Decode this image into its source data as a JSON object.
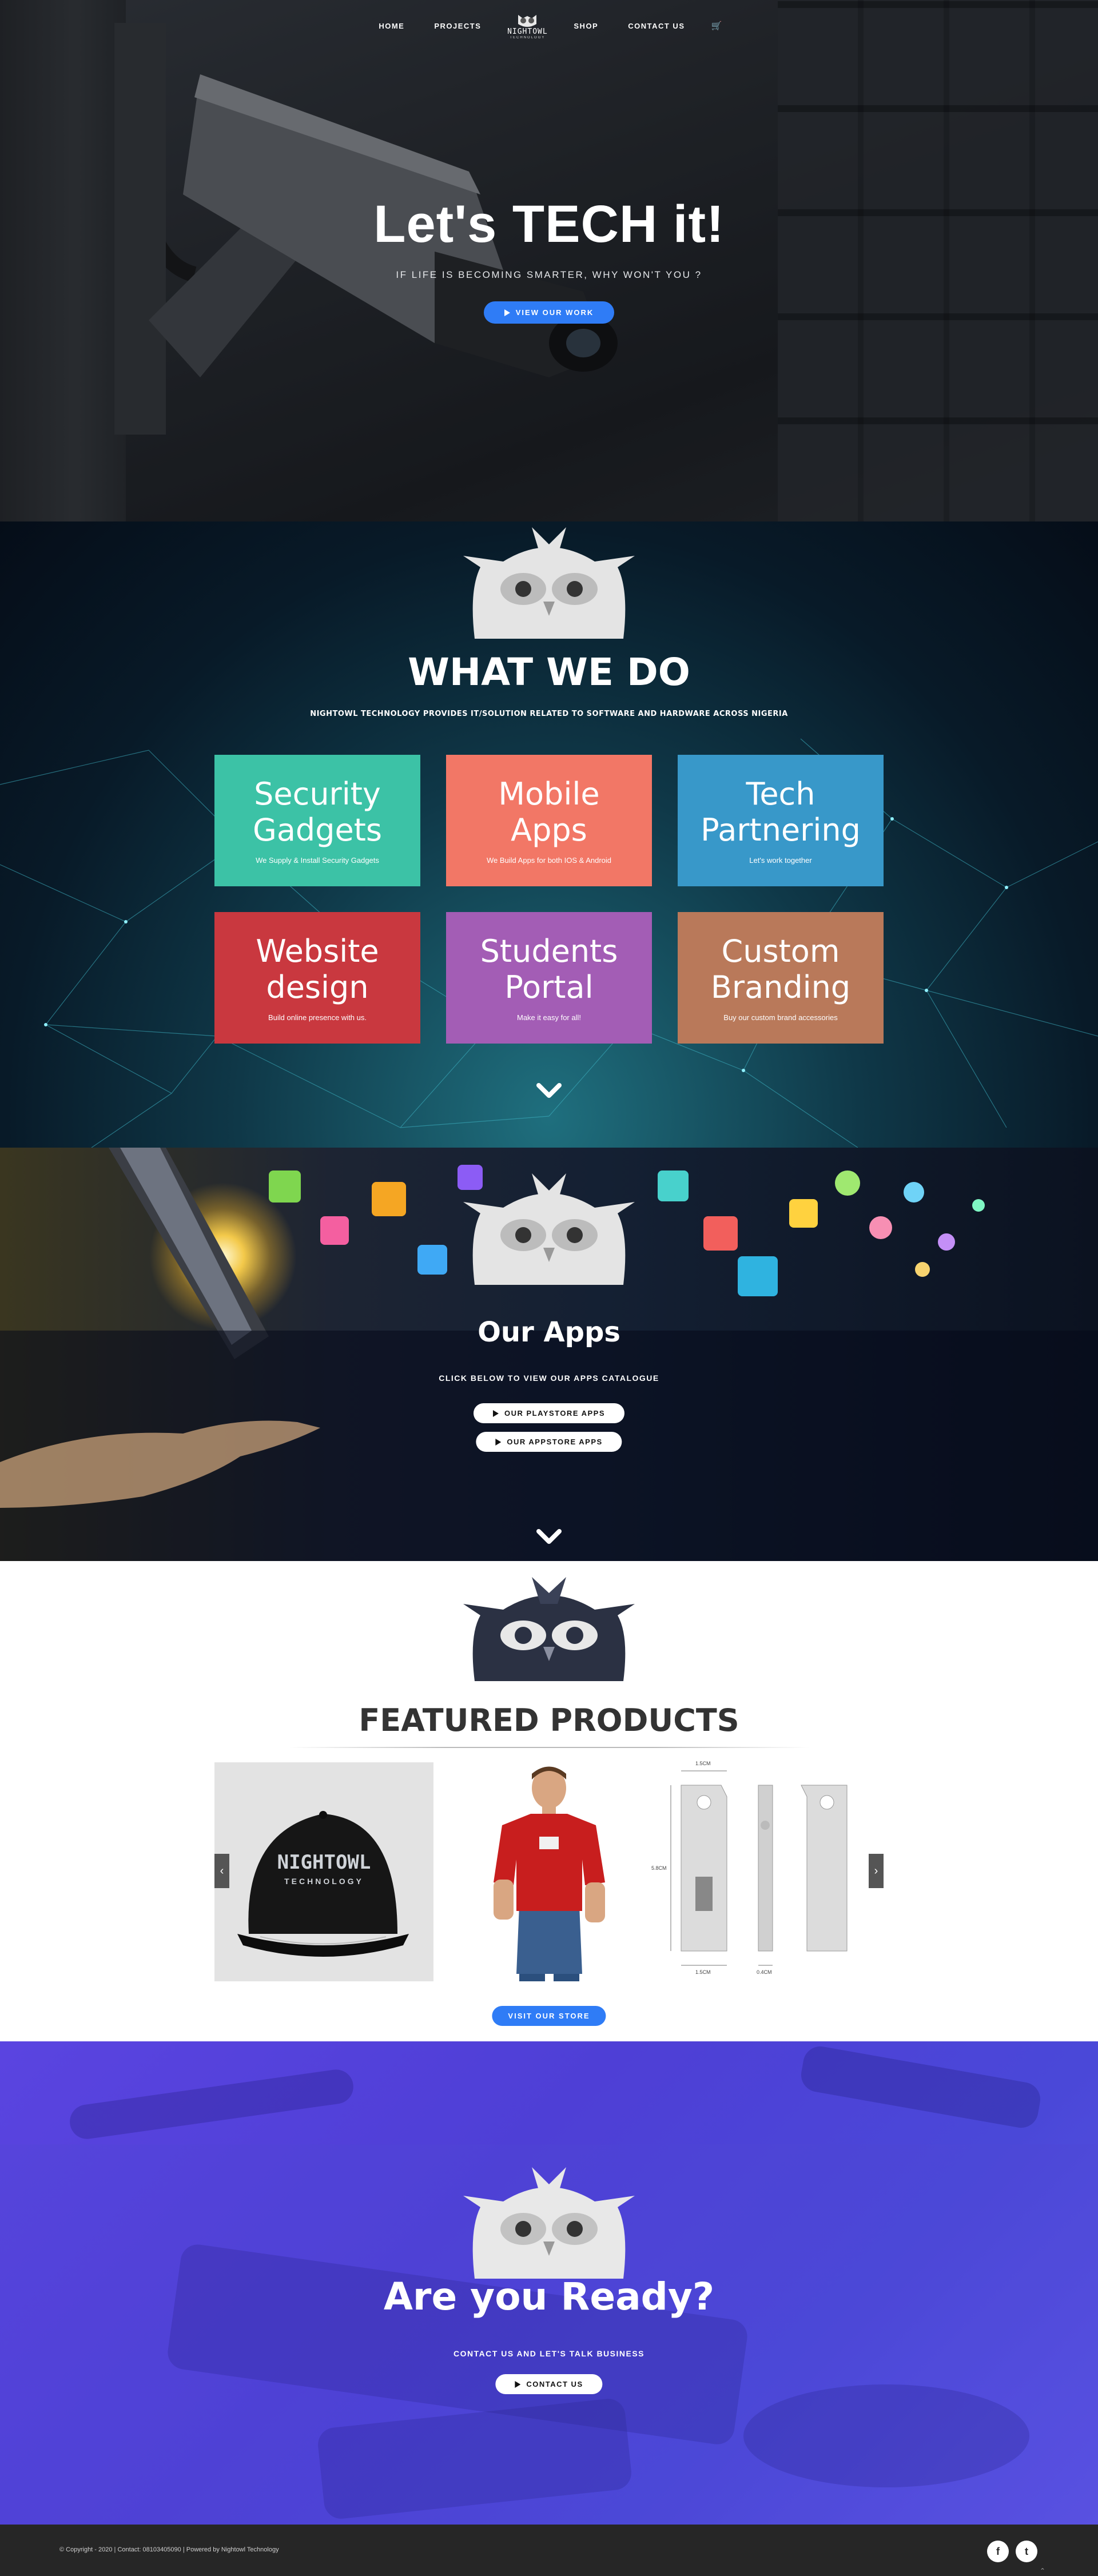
{
  "nav": {
    "items": [
      "HOME",
      "PROJECTS",
      "SHOP",
      "CONTACT US"
    ],
    "logo_name": "NIGHTOWL",
    "logo_sub": "TECHNOLOGY",
    "cart_icon": "cart-icon"
  },
  "hero": {
    "title": "Let's TECH it!",
    "subtitle": "IF LIFE IS BECOMING SMARTER, WHY WON'T YOU ?",
    "button": "VIEW OUR WORK"
  },
  "what_we_do": {
    "title": "WHAT WE DO",
    "subtitle": "NIGHTOWL TECHNOLOGY PROVIDES IT/SOLUTION RELATED TO SOFTWARE AND HARDWARE ACROSS NIGERIA",
    "cards": [
      {
        "title_1": "Security",
        "title_2": "Gadgets",
        "text": "We Supply & Install Security Gadgets",
        "color": "#3cc2a6"
      },
      {
        "title_1": "Mobile",
        "title_2": "Apps",
        "text": "We Build Apps for both IOS & Android",
        "color": "#f27766"
      },
      {
        "title_1": "Tech",
        "title_2": "Partnering",
        "text": "Let's work together",
        "color": "#3898c9"
      },
      {
        "title_1": "Website",
        "title_2": "design",
        "text": "Build online presence with us.",
        "color": "#c9383f"
      },
      {
        "title_1": "Students",
        "title_2": "Portal",
        "text": "Make it easy for all!",
        "color": "#a35db5"
      },
      {
        "title_1": "Custom",
        "title_2": "Branding",
        "text": "Buy our custom brand accessories",
        "color": "#b9795a"
      }
    ]
  },
  "apps": {
    "title": "Our Apps",
    "subtitle": "CLICK BELOW TO VIEW OUR APPS CATALOGUE",
    "playstore_button": "OUR PLAYSTORE APPS",
    "appstore_button": "OUR APPSTORE APPS"
  },
  "featured": {
    "title": "FEATURED PRODUCTS",
    "cap_text_1": "NIGHTOWL",
    "cap_text_2": "TECHNOLOGY",
    "usb_dims": [
      "1.5CM",
      "5.8CM",
      "1.5CM",
      "0.4CM"
    ],
    "button": "VISIT OUR STORE"
  },
  "ready": {
    "title": "Are you Ready?",
    "subtitle": "CONTACT US AND LET'S TALK BUSINESS",
    "button": "CONTACT US"
  },
  "footer": {
    "copyright": "© Copyright - 2020 | Contact: 08103405090 | Powered by Nightowl Technology",
    "facebook": "f",
    "twitter": "t"
  }
}
